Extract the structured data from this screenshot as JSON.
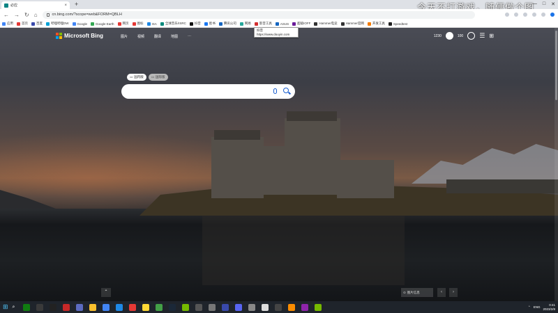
{
  "browser": {
    "tab_title": "必应",
    "url": "cn.bing.com/?scope=web&FORM=QBLH",
    "overlay_text": "今天不打游戏，随便做个图"
  },
  "bookmarks": [
    {
      "label": "应用",
      "color": "#4285f4"
    },
    {
      "label": "首页",
      "color": "#e53935"
    },
    {
      "label": "百度",
      "color": "#3949ab"
    },
    {
      "label": "哔哩哔哩DW",
      "color": "#00a1d6"
    },
    {
      "label": "Google",
      "color": "#4285f4"
    },
    {
      "label": "Google Earth",
      "color": "#34a853"
    },
    {
      "label": "网页",
      "color": "#e53935"
    },
    {
      "label": "图标",
      "color": "#e53935"
    },
    {
      "label": "ISA",
      "color": "#1e88e5"
    },
    {
      "label": "全球音乐/ISRC",
      "color": "#00897b"
    },
    {
      "label": "抖音",
      "color": "#111111"
    },
    {
      "label": "脸书",
      "color": "#1877f2"
    },
    {
      "label": "腾讯公司",
      "color": "#1565c0"
    },
    {
      "label": "网易",
      "color": "#26a69a"
    },
    {
      "label": "影音工具",
      "color": "#d32f2f"
    },
    {
      "label": "ASUS",
      "color": "#1565c0"
    },
    {
      "label": "超级IOFF",
      "color": "#6a1b9a"
    },
    {
      "label": "Hammer电竞",
      "color": "#333333"
    },
    {
      "label": "Hammer官网",
      "color": "#333333"
    },
    {
      "label": "开发工具",
      "color": "#f57c00"
    },
    {
      "label": "Speedtest",
      "color": "#212121"
    }
  ],
  "tooltip": {
    "title": "抖音",
    "url": "https://www.douyin.com"
  },
  "bing": {
    "logo_text": "Microsoft Bing",
    "nav": [
      "图片",
      "视频",
      "翻译",
      "地图",
      "···"
    ],
    "points": "1230",
    "rewards_count": "100",
    "search_tabs": [
      {
        "label": "国内版",
        "active": true
      },
      {
        "label": "国际版",
        "active": false
      }
    ],
    "image_info": "图片信息",
    "scroll_up": "⌃",
    "prev": "‹",
    "next": "›"
  },
  "taskbar": {
    "apps": [
      {
        "name": "xbox",
        "color": "#107c10"
      },
      {
        "name": "obs",
        "color": "#3a3a3a"
      },
      {
        "name": "capcut",
        "color": "#222"
      },
      {
        "name": "mic-app",
        "color": "#c62828"
      },
      {
        "name": "pencil",
        "color": "#5c6bc0"
      },
      {
        "name": "explorer",
        "color": "#fbc02d"
      },
      {
        "name": "chrome",
        "color": "#4285f4"
      },
      {
        "name": "photos",
        "color": "#1e88e5"
      },
      {
        "name": "netease-music",
        "color": "#e53935"
      },
      {
        "name": "chat",
        "color": "#fdd835"
      },
      {
        "name": "wechat",
        "color": "#43a047"
      },
      {
        "name": "steam",
        "color": "#1b2838"
      },
      {
        "name": "nvidia",
        "color": "#76b900"
      },
      {
        "name": "app-1",
        "color": "#555"
      },
      {
        "name": "app-2",
        "color": "#777"
      },
      {
        "name": "speed",
        "color": "#3949ab"
      },
      {
        "name": "discord",
        "color": "#5865f2"
      },
      {
        "name": "app-3",
        "color": "#888"
      },
      {
        "name": "roblox",
        "color": "#ddd"
      },
      {
        "name": "app-4",
        "color": "#444"
      },
      {
        "name": "app-5",
        "color": "#fb8c00"
      },
      {
        "name": "app-6",
        "color": "#8e24aa"
      },
      {
        "name": "nvidia-2",
        "color": "#76b900"
      }
    ],
    "lang": "ENG",
    "time": "0:41",
    "date": "2023/2/8"
  }
}
